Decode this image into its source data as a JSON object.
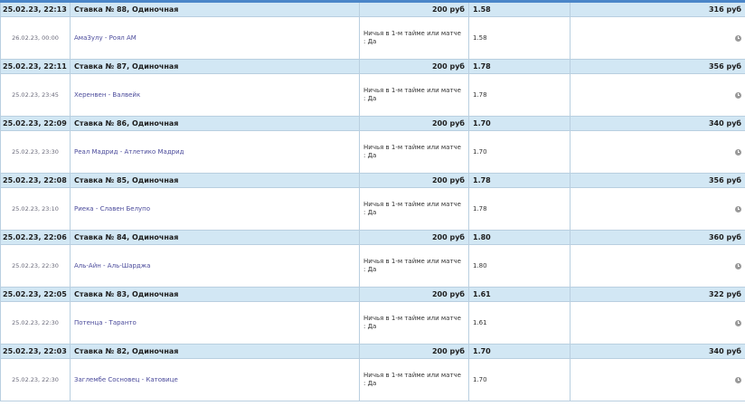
{
  "bets": [
    {
      "placed": "25.02.23, 22:13",
      "title": "Ставка № 88, Одиночная",
      "stake": "200 руб",
      "odds": "1.58",
      "payout": "316 руб",
      "event_date": "26.02.23, 00:00",
      "event": "АмаЗулу - Роял АМ",
      "market": "Ничья в 1-м тайме или матче : Да",
      "event_odds": "1.58",
      "status_icon": "clock-icon"
    },
    {
      "placed": "25.02.23, 22:11",
      "title": "Ставка № 87, Одиночная",
      "stake": "200 руб",
      "odds": "1.78",
      "payout": "356 руб",
      "event_date": "25.02.23, 23:45",
      "event": "Херенвен - Валвейк",
      "market": "Ничья в 1-м тайме или матче : Да",
      "event_odds": "1.78",
      "status_icon": "clock-icon"
    },
    {
      "placed": "25.02.23, 22:09",
      "title": "Ставка № 86, Одиночная",
      "stake": "200 руб",
      "odds": "1.70",
      "payout": "340 руб",
      "event_date": "25.02.23, 23:30",
      "event": "Реал Мадрид - Атлетико Мадрид",
      "market": "Ничья в 1-м тайме или матче : Да",
      "event_odds": "1.70",
      "status_icon": "clock-icon"
    },
    {
      "placed": "25.02.23, 22:08",
      "title": "Ставка № 85, Одиночная",
      "stake": "200 руб",
      "odds": "1.78",
      "payout": "356 руб",
      "event_date": "25.02.23, 23:10",
      "event": "Риека - Славен Белупо",
      "market": "Ничья в 1-м тайме или матче : Да",
      "event_odds": "1.78",
      "status_icon": "clock-icon"
    },
    {
      "placed": "25.02.23, 22:06",
      "title": "Ставка № 84, Одиночная",
      "stake": "200 руб",
      "odds": "1.80",
      "payout": "360 руб",
      "event_date": "25.02.23, 22:30",
      "event": "Аль-Айн - Аль-Шарджа",
      "market": "Ничья в 1-м тайме или матче : Да",
      "event_odds": "1.80",
      "status_icon": "clock-icon"
    },
    {
      "placed": "25.02.23, 22:05",
      "title": "Ставка № 83, Одиночная",
      "stake": "200 руб",
      "odds": "1.61",
      "payout": "322 руб",
      "event_date": "25.02.23, 22:30",
      "event": "Потенца - Таранто",
      "market": "Ничья в 1-м тайме или матче : Да",
      "event_odds": "1.61",
      "status_icon": "clock-icon"
    },
    {
      "placed": "25.02.23, 22:03",
      "title": "Ставка № 82, Одиночная",
      "stake": "200 руб",
      "odds": "1.70",
      "payout": "340 руб",
      "event_date": "25.02.23, 22:30",
      "event": "Заглембе Сосновец - Катовице",
      "market": "Ничья в 1-м тайме или матче : Да",
      "event_odds": "1.70",
      "status_icon": "clock-icon"
    }
  ]
}
